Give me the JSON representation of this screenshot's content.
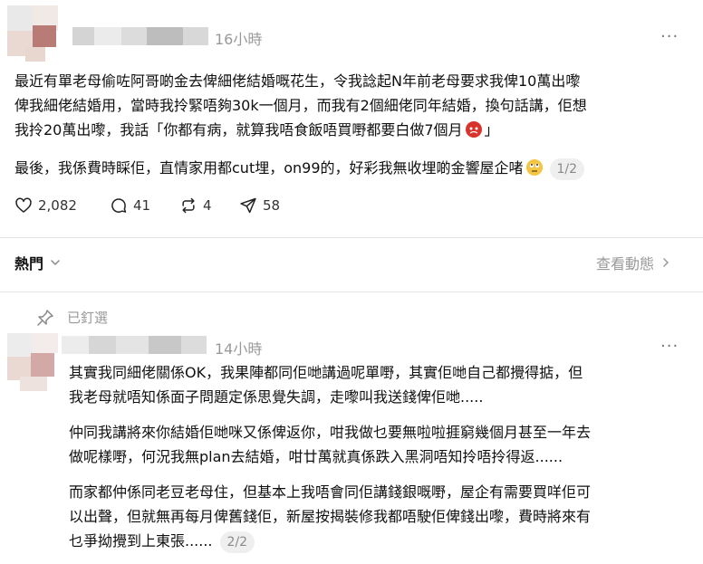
{
  "post": {
    "timestamp": "16小時",
    "more_label": "···",
    "paragraphs": [
      "最近有單老母偷咗阿哥啲金去俾細佬結婚嘅花生，令我諗起N年前老母要求我俾10萬出嚟",
      "俾我細佬結婚用，當時我拎緊唔夠30k一個月，而我有2個細佬同年結婚，換句話講，佢想",
      "我拎20萬出嚟，我話「你都有病，就算我唔食飯唔買嘢都要白做7個月",
      "」",
      "最後，我係費時睬佢，直情家用都cut埋，on99的，好彩我無收埋啲金響屋企啫"
    ],
    "pager": "1/2",
    "stats": {
      "likes": "2,082",
      "comments": "41",
      "reposts": "4",
      "shares": "58"
    }
  },
  "sort": {
    "label": "熱門",
    "view_activity": "查看動態"
  },
  "reply": {
    "pinned_label": "已釘選",
    "timestamp": "14小時",
    "more_label": "···",
    "lines": [
      "其實我同細佬關係OK，我果陣都同佢哋講過呢單嘢，其實佢哋自己都攪得掂，但",
      "我老母就唔知係面子問題定係思覺失調，走嚟叫我送錢俾佢哋.....",
      "仲同我講將來你結婚佢哋咪又係俾返你，咁我做乜要無啦啦捱窮幾個月甚至一年去",
      "做呢樣嘢，何況我無plan去結婚，咁廿萬就真係跌入黑洞唔知拎唔拎得返......",
      "而家都仲係同老豆老母住，但基本上我唔會同佢講錢銀嘅嘢，屋企有需要買咩佢可",
      "以出聲，但就無再每月俾舊錢佢，新屋按揭裝修我都唔駛佢俾錢出嚟，費時將來有",
      "乜爭拗攪到上東張......"
    ],
    "pager": "2/2"
  },
  "colors": {
    "emoji_angry": "#d9342b",
    "emoji_eyeroll": "#f4c542"
  }
}
